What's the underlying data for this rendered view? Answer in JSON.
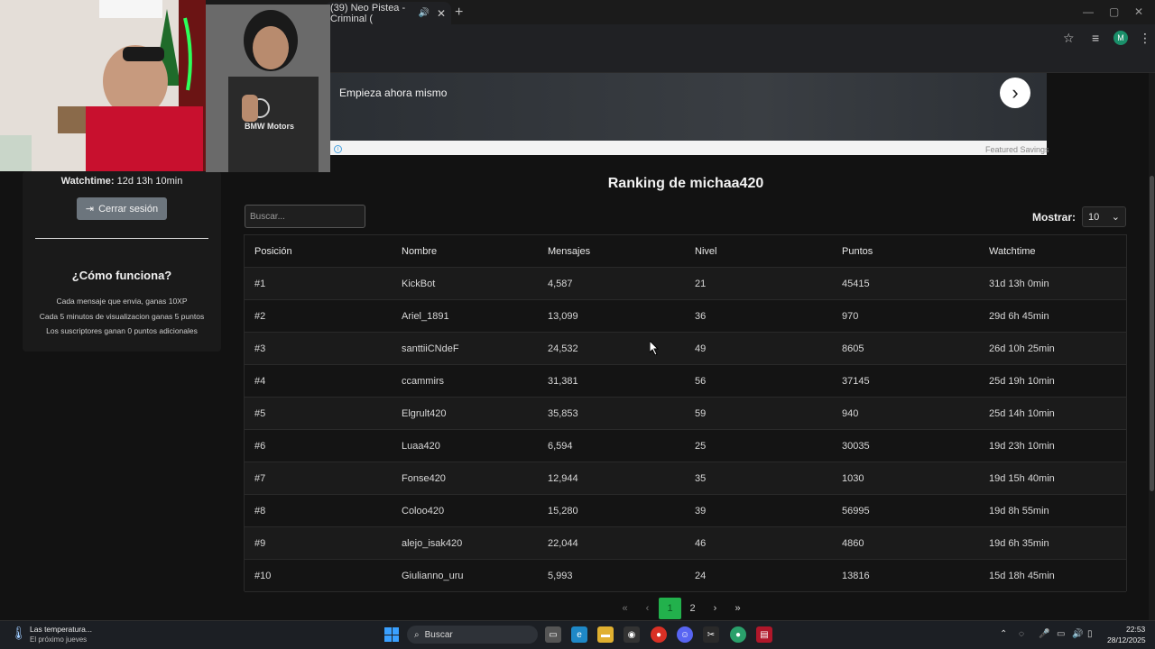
{
  "browser": {
    "tab_title": "(39) Neo Pistea - Criminal (",
    "mute_icon": "speaker-icon",
    "close_icon": "close-icon",
    "new_tab": "+"
  },
  "ad": {
    "text": "Empieza ahora mismo",
    "arrow": "›",
    "sponsor": "Featured Savings",
    "info": "i"
  },
  "sidebar": {
    "watchtime_label": "Watchtime:",
    "watchtime_value": "12d 13h 10min",
    "logout_label": "Cerrar sesión",
    "how_title": "¿Cómo funciona?",
    "how_lines": [
      "Cada mensaje que envia, ganas 10XP",
      "Cada 5 minutos de visualizacion ganas 5 puntos",
      "Los suscriptores ganan 0 puntos adicionales"
    ]
  },
  "ranking": {
    "title": "Ranking de michaa420",
    "search_placeholder": "Buscar...",
    "show_label": "Mostrar:",
    "show_value": "10",
    "columns": [
      "Posición",
      "Nombre",
      "Mensajes",
      "Nivel",
      "Puntos",
      "Watchtime"
    ],
    "rows": [
      [
        "#1",
        "KickBot",
        "4,587",
        "21",
        "45415",
        "31d 13h 0min"
      ],
      [
        "#2",
        "Ariel_1891",
        "13,099",
        "36",
        "970",
        "29d 6h 45min"
      ],
      [
        "#3",
        "santtiiCNdeF",
        "24,532",
        "49",
        "8605",
        "26d 10h 25min"
      ],
      [
        "#4",
        "ccammirs",
        "31,381",
        "56",
        "37145",
        "25d 19h 10min"
      ],
      [
        "#5",
        "Elgrult420",
        "35,853",
        "59",
        "940",
        "25d 14h 10min"
      ],
      [
        "#6",
        "Luaa420",
        "6,594",
        "25",
        "30035",
        "19d 23h 10min"
      ],
      [
        "#7",
        "Fonse420",
        "12,944",
        "35",
        "1030",
        "19d 15h 40min"
      ],
      [
        "#8",
        "Coloo420",
        "15,280",
        "39",
        "56995",
        "19d 8h 55min"
      ],
      [
        "#9",
        "alejo_isak420",
        "22,044",
        "46",
        "4860",
        "19d 6h 35min"
      ],
      [
        "#10",
        "Giulianno_uru",
        "5,993",
        "24",
        "13816",
        "15d 18h 45min"
      ]
    ],
    "pager": {
      "first": "«",
      "prev": "‹",
      "pages": [
        "1",
        "2"
      ],
      "next": "›",
      "last": "»"
    }
  },
  "taskbar": {
    "weather_title": "Las temperatura...",
    "weather_sub": "El próximo jueves",
    "search_label": "Buscar",
    "time": "22:53",
    "date": "28/12/2025",
    "colors": {
      "start": "#3aa0ff",
      "pager_active": "#22b14c"
    }
  },
  "webcams": {
    "cam2_shirt_text": "BMW Motors"
  }
}
